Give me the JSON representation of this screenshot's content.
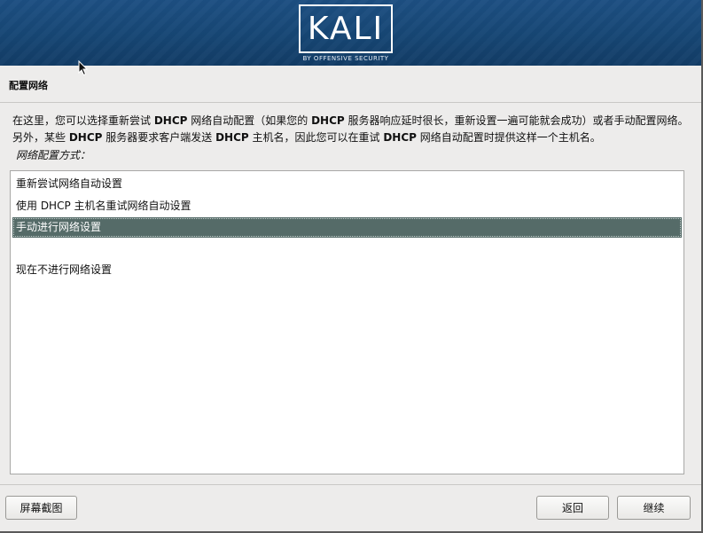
{
  "header": {
    "logo_text": "KALI",
    "logo_subtitle": "BY OFFENSIVE SECURITY"
  },
  "page": {
    "title": "配置网络",
    "description_parts": [
      "在这里，您可以选择重新尝试 ",
      "DHCP",
      " 网络自动配置（如果您的 ",
      "DHCP",
      " 服务器响应延时很长，重新设置一遍可能就会成功）或者手动配置网络。另外，某些 ",
      "DHCP",
      " 服务器要求客户端发送 ",
      "DHCP",
      " 主机名，因此您可以在重试 ",
      "DHCP",
      " 网络自动配置时提供这样一个主机名。"
    ],
    "prompt": "网络配置方式："
  },
  "options": {
    "items": [
      {
        "label": "重新尝试网络自动设置",
        "selected": false
      },
      {
        "label": "使用 DHCP 主机名重试网络自动设置",
        "selected": false
      },
      {
        "label": "手动进行网络设置",
        "selected": true
      },
      {
        "label": "",
        "selected": false
      },
      {
        "label": "现在不进行网络设置",
        "selected": false
      }
    ]
  },
  "buttons": {
    "screenshot": "屏幕截图",
    "back": "返回",
    "continue": "继续"
  },
  "colors": {
    "banner": "#164674",
    "selected_row": "#556b68",
    "background": "#edeceb"
  }
}
